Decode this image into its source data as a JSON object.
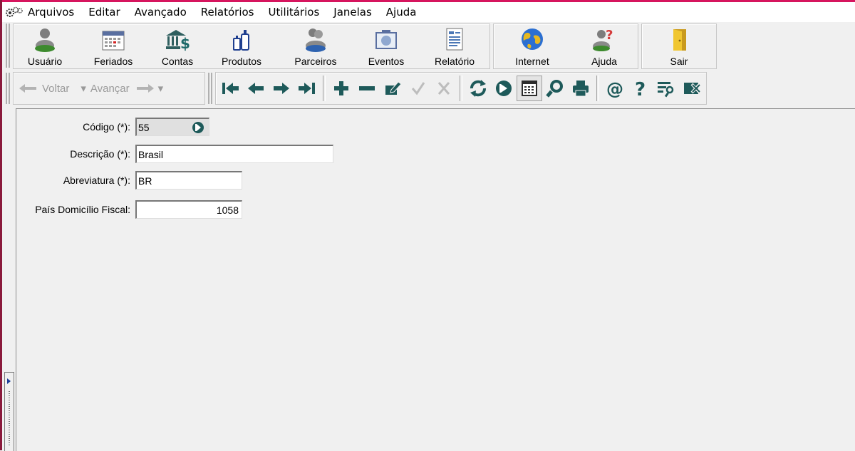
{
  "menu": {
    "items": [
      "Arquivos",
      "Editar",
      "Avançado",
      "Relatórios",
      "Utilitários",
      "Janelas",
      "Ajuda"
    ]
  },
  "toolbar": {
    "buttons": [
      {
        "label": "Usuário",
        "icon": "users-icon"
      },
      {
        "label": "Feriados",
        "icon": "calendar-icon"
      },
      {
        "label": "Contas",
        "icon": "bank-icon"
      },
      {
        "label": "Produtos",
        "icon": "bottles-icon"
      },
      {
        "label": "Parceiros",
        "icon": "partners-icon"
      },
      {
        "label": "Eventos",
        "icon": "events-icon"
      },
      {
        "label": "Relatório",
        "icon": "report-icon"
      },
      {
        "label": "Internet",
        "icon": "globe-icon"
      },
      {
        "label": "Ajuda",
        "icon": "help-user-icon"
      },
      {
        "label": "Sair",
        "icon": "door-icon"
      }
    ]
  },
  "nav": {
    "back_label": "Voltar",
    "forward_label": "Avançar"
  },
  "form": {
    "codigo": {
      "label": "Código (*):",
      "value": "55"
    },
    "descricao": {
      "label": "Descrição (*):",
      "value": "Brasil"
    },
    "abreviatura": {
      "label": "Abreviatura (*):",
      "value": "BR"
    },
    "pais_fiscal": {
      "label": "País Domicílio Fiscal:",
      "value": "1058"
    }
  },
  "colors": {
    "accent_border": "#d6155e",
    "icon_blue": "#1f3f8f",
    "icon_teal": "#1e5a5a",
    "disabled": "#b8b8b8"
  }
}
